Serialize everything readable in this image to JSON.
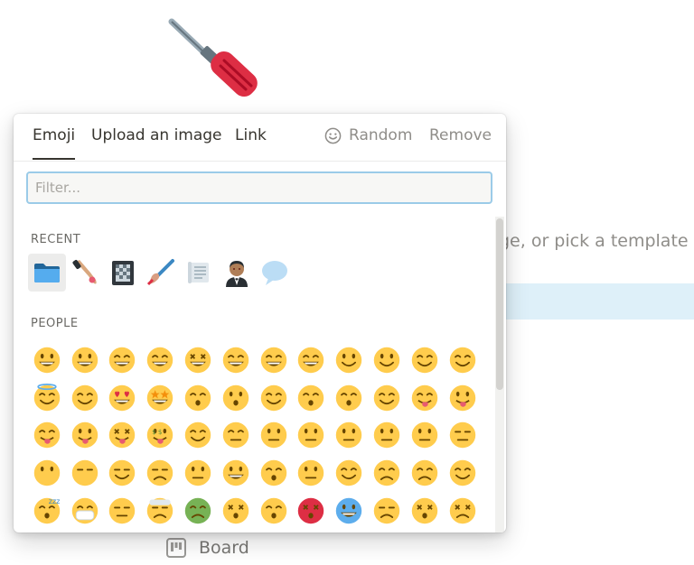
{
  "background": {
    "hint_text": "ge, or pick a template (",
    "board_label": "Board"
  },
  "page_icon": "screwdriver-icon",
  "picker": {
    "tabs": [
      {
        "label": "Emoji",
        "active": true
      },
      {
        "label": "Upload an image",
        "active": false
      },
      {
        "label": "Link",
        "active": false
      }
    ],
    "random_label": "Random",
    "remove_label": "Remove",
    "filter_placeholder": "Filter...",
    "sections": {
      "recent": "RECENT",
      "people": "PEOPLE"
    },
    "recent_icons": [
      "folder-icon",
      "nail-polish-icon",
      "notebook-icon",
      "paintbrush-icon",
      "scroll-icon",
      "man-in-tuxedo-icon",
      "speech-bubble-icon"
    ],
    "people_emoji_rows": [
      [
        "grinning",
        "smiley",
        "smile",
        "grin",
        "laughing",
        "sweat-smile",
        "rofl",
        "joy",
        "slight-smile",
        "upside-down",
        "wink",
        "blush"
      ],
      [
        "innocent",
        "smiling-hearts",
        "heart-eyes",
        "star-struck",
        "kissing-heart",
        "kissing",
        "relaxed",
        "kissing-closed-eyes",
        "kissing-smiling-eyes",
        "smiling-tear",
        "yum",
        "tongue"
      ],
      [
        "winking-tongue",
        "zany",
        "squinting-tongue",
        "money-mouth",
        "hugging",
        "hand-over-mouth",
        "shushing",
        "thinking",
        "zipper-mouth",
        "raised-eyebrow",
        "neutral",
        "expressionless"
      ],
      [
        "no-mouth",
        "face-in-clouds",
        "smirk",
        "unamused",
        "rolling-eyes",
        "grimacing",
        "face-exhaling",
        "lying",
        "relieved",
        "pensive",
        "sleepy",
        "drooling"
      ],
      [
        "sleeping",
        "mask",
        "thermometer",
        "head-bandage",
        "nauseated",
        "vomiting",
        "sneezing",
        "hot",
        "cold",
        "woozy",
        "dizzy",
        "spiral-eyes"
      ]
    ],
    "colors": {
      "emoji_yellow": "#ffcc4d",
      "emoji_feature": "#664500",
      "filter_border": "#9bcbe8",
      "bar_blue": "#def0f9"
    }
  }
}
